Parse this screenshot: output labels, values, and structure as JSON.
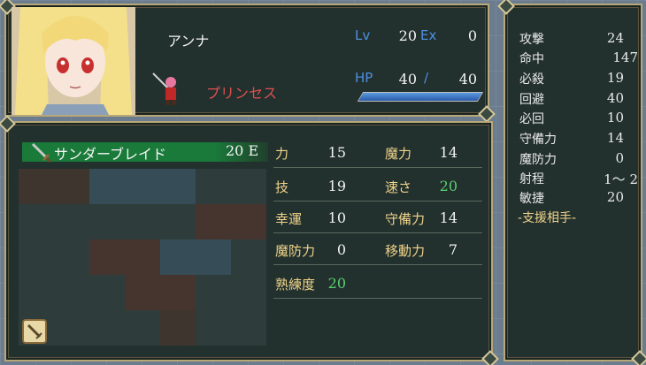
{
  "unit": {
    "name": "アンナ",
    "class": "プリンセス",
    "lv_label": "Lv",
    "lv": "20",
    "ex_label": "Ex",
    "ex": "0",
    "hp_label": "HP",
    "hp_current": "40",
    "hp_sep": "/",
    "hp_max": "40",
    "hp_fraction": 1.0
  },
  "weapon": {
    "name": "サンダーブレイド",
    "uses": "20 E",
    "icon": "sword-icon"
  },
  "stats": [
    {
      "label": "力",
      "value": "15"
    },
    {
      "label": "魔力",
      "value": "14"
    },
    {
      "label": "技",
      "value": "19"
    },
    {
      "label": "速さ",
      "value": "20"
    },
    {
      "label": "幸運",
      "value": "10"
    },
    {
      "label": "守備力",
      "value": "14"
    },
    {
      "label": "魔防力",
      "value": "0"
    },
    {
      "label": "移動力",
      "value": "7"
    },
    {
      "label": "熟練度",
      "value": "20"
    }
  ],
  "combat": [
    {
      "label": "攻撃",
      "value": "24"
    },
    {
      "label": "命中",
      "value": "147"
    },
    {
      "label": "必殺",
      "value": "19"
    },
    {
      "label": "回避",
      "value": "40"
    },
    {
      "label": "必回",
      "value": "10"
    },
    {
      "label": "守備力",
      "value": "14"
    },
    {
      "label": "魔防力",
      "value": "0"
    },
    {
      "label": "射程",
      "value": "1〜 2"
    },
    {
      "label": "敏捷",
      "value": "20"
    }
  ],
  "support_label": "-支援相手-",
  "colors": {
    "accent_blue": "#4f8fe0",
    "class_red": "#e05050",
    "stat_gold": "#f0d48a",
    "highlight_green": "#5ad070",
    "weapon_bar": "#1a7a3a"
  }
}
